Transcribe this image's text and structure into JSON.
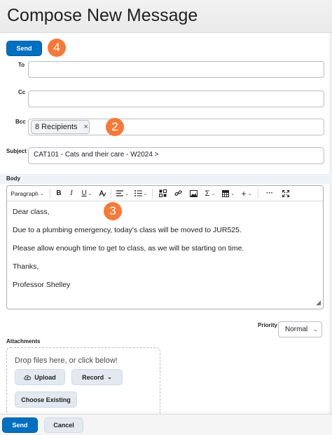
{
  "header": {
    "title": "Compose New Message"
  },
  "top_actions": {
    "send_label": "Send",
    "callout": "4"
  },
  "to": {
    "label": "To",
    "value": ""
  },
  "cc": {
    "label": "Cc",
    "value": ""
  },
  "bcc": {
    "label": "Bcc",
    "chip": "8 Recipients",
    "chip_remove": "×",
    "callout": "2"
  },
  "subject": {
    "label": "Subject",
    "prefix": "CAT101 - Cats and their care - W2024 >"
  },
  "body": {
    "label": "Body",
    "toolbar": {
      "paragraph": "Paragraph",
      "bold": "B",
      "italic": "I",
      "underline": "U",
      "more": "···"
    },
    "callout": "3",
    "lines": [
      "Dear class,",
      "Due to a plumbing emergency, today's class will be moved to JUR525.",
      "Please allow enough time to get to class, as we will be starting on time.",
      "Thanks,",
      "Professor Shelley"
    ]
  },
  "priority": {
    "label": "Priority",
    "value": "Normal"
  },
  "attachments": {
    "label": "Attachments",
    "drop_text": "Drop files here, or click below!",
    "upload_label": "Upload",
    "record_label": "Record",
    "choose_existing_label": "Choose Existing"
  },
  "footer": {
    "send_label": "Send",
    "cancel_label": "Cancel"
  },
  "colors": {
    "primary": "#006fbf",
    "callout": "#f47a3b",
    "secondary_button": "#e3e9f1"
  }
}
